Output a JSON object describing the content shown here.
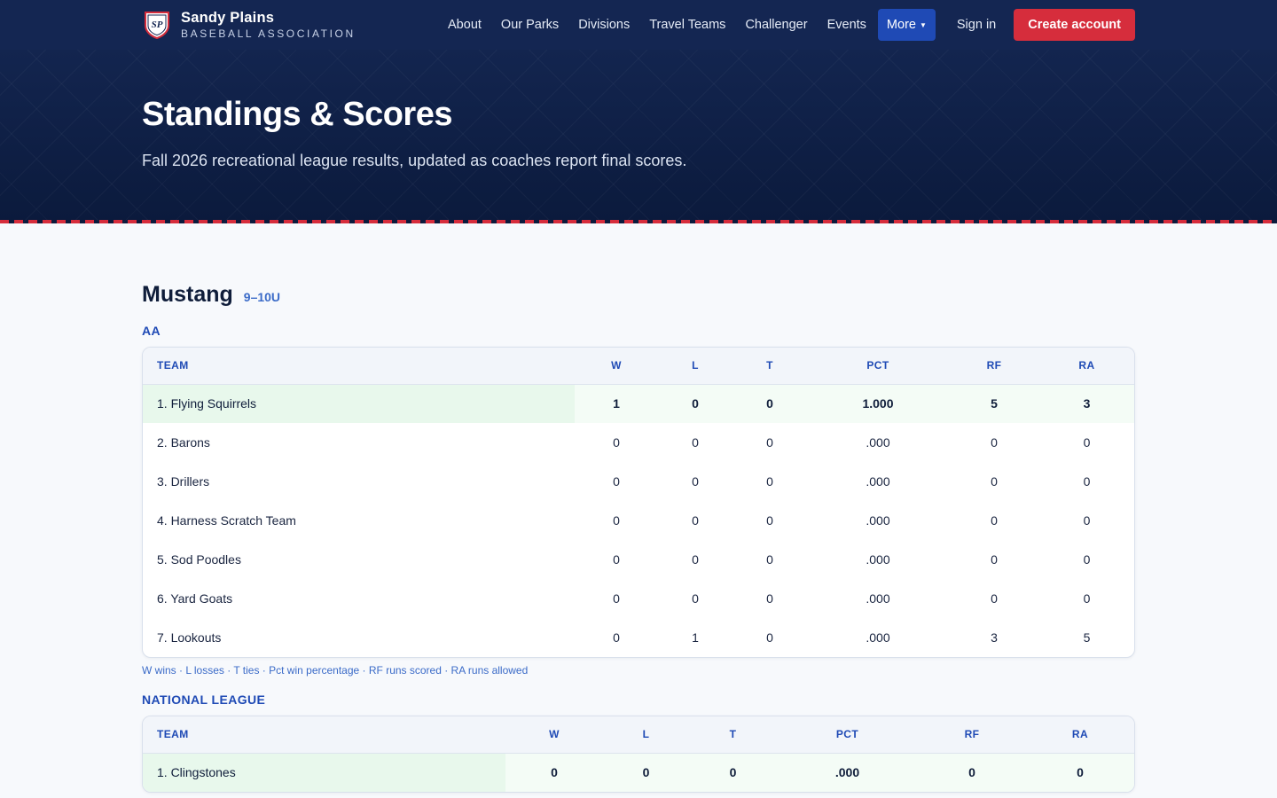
{
  "brand": {
    "initials": "SP",
    "title": "Sandy Plains",
    "subtitle": "BASEBALL ASSOCIATION"
  },
  "nav": {
    "items": [
      "About",
      "Our Parks",
      "Divisions",
      "Travel Teams",
      "Challenger",
      "Events"
    ],
    "more_label": "More",
    "signin_label": "Sign in",
    "create_label": "Create account"
  },
  "hero": {
    "title": "Standings & Scores",
    "subtitle": "Fall 2026 recreational league results, updated as coaches report final scores."
  },
  "division": {
    "name": "Mustang",
    "age": "9–10U"
  },
  "columns": [
    "TEAM",
    "W",
    "L",
    "T",
    "PCT",
    "RF",
    "RA"
  ],
  "legend": "W wins · L losses · T ties · Pct win percentage · RF runs scored · RA runs allowed",
  "leagues": [
    {
      "name": "AA",
      "rows": [
        {
          "team": "1. Flying Squirrels",
          "w": "1",
          "l": "0",
          "t": "0",
          "pct": "1.000",
          "rf": "5",
          "ra": "3"
        },
        {
          "team": "2. Barons",
          "w": "0",
          "l": "0",
          "t": "0",
          "pct": ".000",
          "rf": "0",
          "ra": "0"
        },
        {
          "team": "3. Drillers",
          "w": "0",
          "l": "0",
          "t": "0",
          "pct": ".000",
          "rf": "0",
          "ra": "0"
        },
        {
          "team": "4. Harness Scratch Team",
          "w": "0",
          "l": "0",
          "t": "0",
          "pct": ".000",
          "rf": "0",
          "ra": "0"
        },
        {
          "team": "5. Sod Poodles",
          "w": "0",
          "l": "0",
          "t": "0",
          "pct": ".000",
          "rf": "0",
          "ra": "0"
        },
        {
          "team": "6. Yard Goats",
          "w": "0",
          "l": "0",
          "t": "0",
          "pct": ".000",
          "rf": "0",
          "ra": "0"
        },
        {
          "team": "7. Lookouts",
          "w": "0",
          "l": "1",
          "t": "0",
          "pct": ".000",
          "rf": "3",
          "ra": "5"
        }
      ]
    },
    {
      "name": "NATIONAL LEAGUE",
      "rows": [
        {
          "team": "1. Clingstones",
          "w": "0",
          "l": "0",
          "t": "0",
          "pct": ".000",
          "rf": "0",
          "ra": "0"
        }
      ]
    }
  ],
  "colors": {
    "navy": "#142652",
    "accent_blue": "#1f4ab5",
    "accent_red": "#d62d3c",
    "leader_row": "#e8f8ec"
  }
}
